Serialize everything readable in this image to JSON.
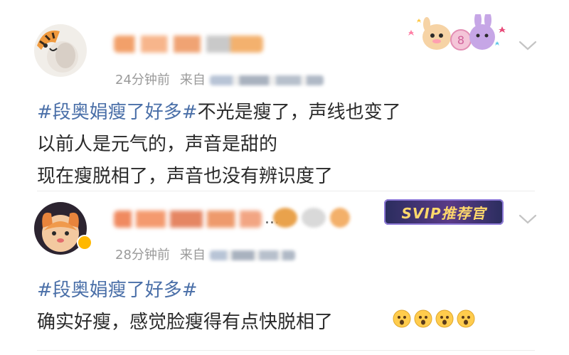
{
  "posts": [
    {
      "username": "",
      "time": "24分钟前",
      "source_prefix": "来自",
      "topic": "#段奥娟瘦了好多#",
      "lines": [
        "不光是瘦了，声线也变了",
        "以前人是元气的，声音是甜的",
        "现在瘦脱相了，声音也没有辨识度了"
      ],
      "icons": [
        "avatar",
        "sticker-decoration",
        "chevron-down-icon"
      ]
    },
    {
      "username": "",
      "time": "28分钟前",
      "source_prefix": "来自",
      "badge": "SVIP推荐官",
      "topic": "#段奥娟瘦了好多#",
      "lines": [
        "确实好瘦，感觉脸瘦得有点快脱相了"
      ],
      "emoji_count": 4,
      "icons": [
        "avatar",
        "verified-badge-icon",
        "chevron-down-icon",
        "surprised-face-emoji"
      ]
    }
  ],
  "ellipsis": "...",
  "colors": {
    "topic": "#4a6fa8",
    "meta": "#9a9a9a",
    "text": "#2a2a2a",
    "verified": "#ffb800"
  }
}
